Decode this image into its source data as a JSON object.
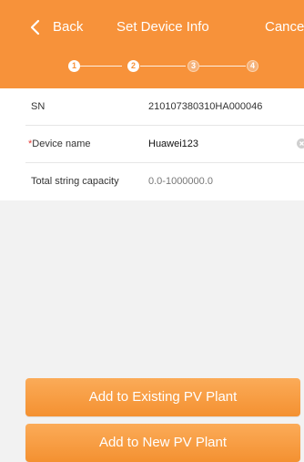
{
  "nav": {
    "back_label": "Back",
    "title": "Set Device Info",
    "cancel_label": "Cance"
  },
  "steps": {
    "items": [
      {
        "number": "1",
        "state": "active"
      },
      {
        "number": "2",
        "state": "active"
      },
      {
        "number": "3",
        "state": "inactive"
      },
      {
        "number": "4",
        "state": "inactive"
      }
    ]
  },
  "form": {
    "sn": {
      "label": "SN",
      "value": "210107380310HA000046"
    },
    "device_name": {
      "required_mark": "*",
      "label": "Device name",
      "value": "Huawei123"
    },
    "string_capacity": {
      "label": "Total string capacity",
      "placeholder": "0.0-1000000.0"
    }
  },
  "actions": {
    "existing_label": "Add to Existing PV Plant",
    "new_label": "Add to New PV Plant"
  },
  "icons": {
    "back": "chevron-left-icon",
    "clear": "clear-icon"
  },
  "colors": {
    "accent": "#f7923a",
    "background": "#f2f2f2",
    "required": "#e53935"
  }
}
